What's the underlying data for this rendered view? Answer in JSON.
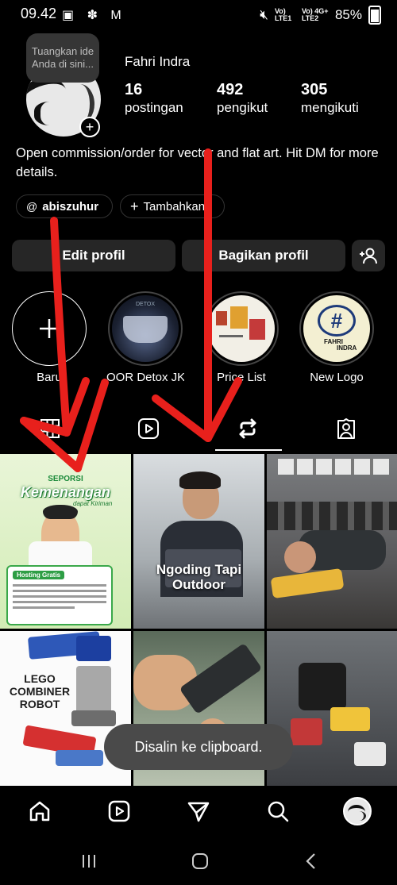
{
  "status_bar": {
    "time": "09.42",
    "icons": "▣ ✽ M",
    "network_1": "Vo) LTE1",
    "network_2": "Vo) 4G+ LTE2",
    "battery": "85%"
  },
  "profile": {
    "note_placeholder": "Tuangkan ide Anda di sini...",
    "name": "Fahri Indra",
    "stats": [
      {
        "value": "16",
        "label": "postingan"
      },
      {
        "value": "492",
        "label": "pengikut"
      },
      {
        "value": "305",
        "label": "mengikuti"
      }
    ],
    "bio": "Open commission/order for vector and flat art. Hit DM for more details.",
    "threads_handle": "abiszuhur",
    "add_link_label": "Tambahkan"
  },
  "buttons": {
    "edit_profile": "Edit profil",
    "share_profile": "Bagikan profil"
  },
  "highlights": [
    {
      "label": "Baru"
    },
    {
      "label": "OOR Detox JK..."
    },
    {
      "label": "Price List"
    },
    {
      "label": "New Logo"
    }
  ],
  "highlight_logo": {
    "line1": "FAHRI",
    "line2": "INDRA"
  },
  "highlight_detox_text": "DETOX",
  "tabs": [
    "grid-icon",
    "reels-icon",
    "repost-icon",
    "tagged-icon"
  ],
  "grid_posts": [
    {
      "title": "Kemenangan",
      "subtitle": "SEPORSI",
      "script": "dapat Kiriman",
      "badge": "Hosting Gratis"
    },
    {
      "caption": "Ngoding Tapi Outdoor"
    },
    {
      "caption": ""
    },
    {
      "caption": "LEGO COMBINER ROBOT"
    },
    {
      "caption": ""
    },
    {
      "caption": ""
    }
  ],
  "toast": "Disalin ke clipboard.",
  "bottom_nav": [
    "home-icon",
    "reels-icon",
    "send-icon",
    "search-icon",
    "profile-avatar"
  ],
  "system_nav": [
    "recents-button",
    "home-button",
    "back-button"
  ],
  "colors": {
    "background": "#000000",
    "button_bg": "#262626",
    "annotation_red": "#e8201c"
  }
}
